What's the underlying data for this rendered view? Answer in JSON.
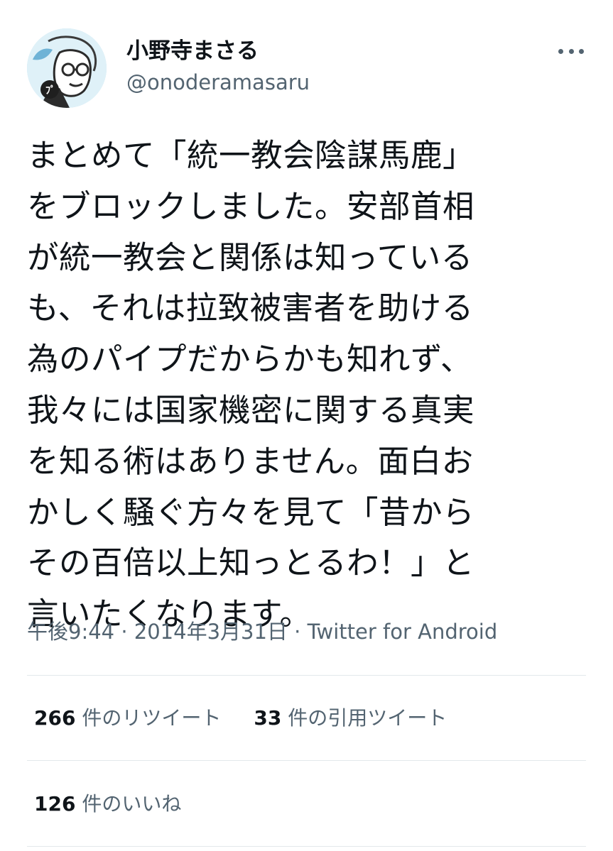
{
  "author": {
    "display_name": "小野寺まさる",
    "handle": "@onoderamasaru",
    "avatar_icon": "avatar-portrait-icon"
  },
  "more_icon": "more-dots-icon",
  "tweet": {
    "text": "まとめて「統一教会陰謀馬鹿」\nをブロックしました。安部首相\nが統一教会と関係は知っている\nも、それは拉致被害者を助ける\n為のパイプだからかも知れず、\n我々には国家機密に関する真実\nを知る術はありません。面白お\nかしく騒ぐ方々を見て「昔から\nその百倍以上知っとるわ！」と\n言いたくなります。"
  },
  "meta": {
    "time": "午後9:44",
    "separator": " · ",
    "date": "2014年3月31日",
    "source": "Twitter for Android"
  },
  "stats": {
    "retweets_count": "266",
    "retweets_label": " 件のリツイート",
    "quotes_count": "33",
    "quotes_label": " 件の引用ツイート",
    "likes_count": "126",
    "likes_label": " 件のいいね"
  },
  "colors": {
    "text": "#0f1419",
    "secondary": "#536471",
    "divider": "#e3e8eb"
  }
}
